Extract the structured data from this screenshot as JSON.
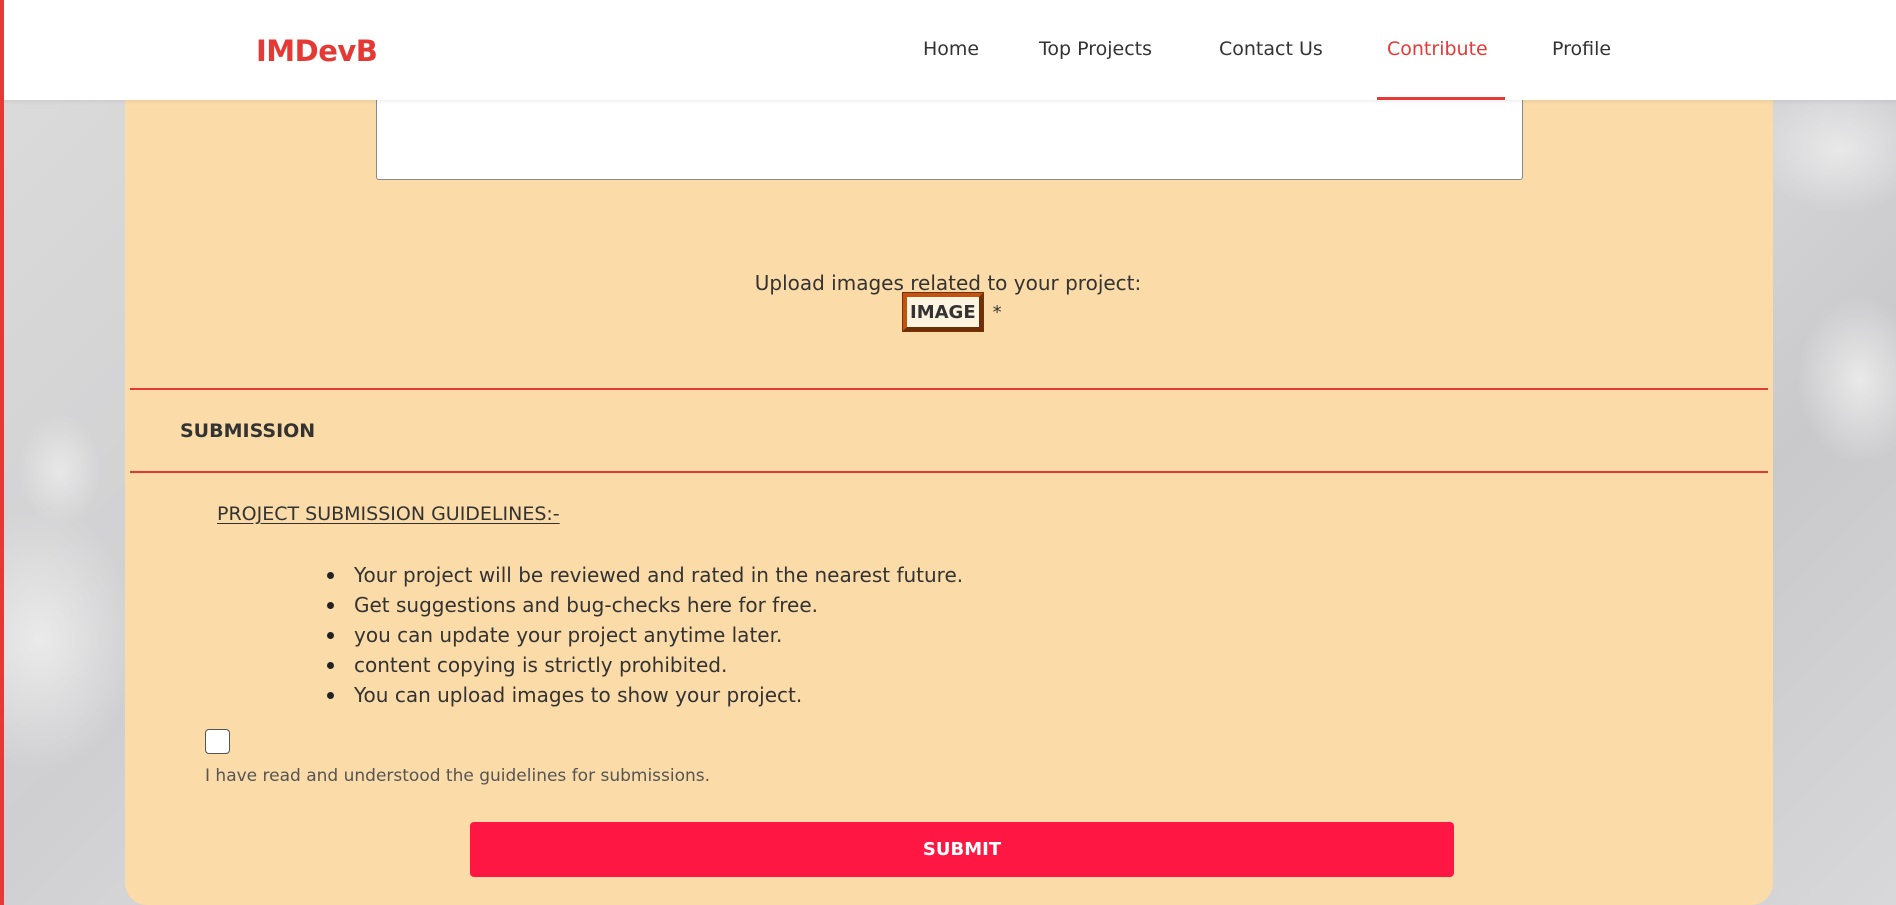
{
  "nav": {
    "logo": "IMDevB",
    "links": [
      "Home",
      "Top Projects",
      "Contact Us",
      "Contribute",
      "Profile"
    ],
    "active": "Contribute"
  },
  "upload": {
    "label": "Upload images related to your project:",
    "button": "IMAGE",
    "required_mark": "*"
  },
  "submission": {
    "section_title": "SUBMISSION",
    "guidelines_title": "PROJECT SUBMISSION GUIDELINES:-",
    "guidelines": [
      "Your project will be reviewed and rated in the nearest future.",
      "Get suggestions and bug-checks here for free.",
      "you can update your project anytime later.",
      "content copying is strictly prohibited.",
      "You can upload images to show your project."
    ],
    "consent_label": "I have read and understood the guidelines for submissions.",
    "consent_checked": false,
    "submit_label": "SUBMIT"
  },
  "colors": {
    "accent": "#e53935",
    "card": "#fbdba8",
    "submit": "#ff1744"
  }
}
